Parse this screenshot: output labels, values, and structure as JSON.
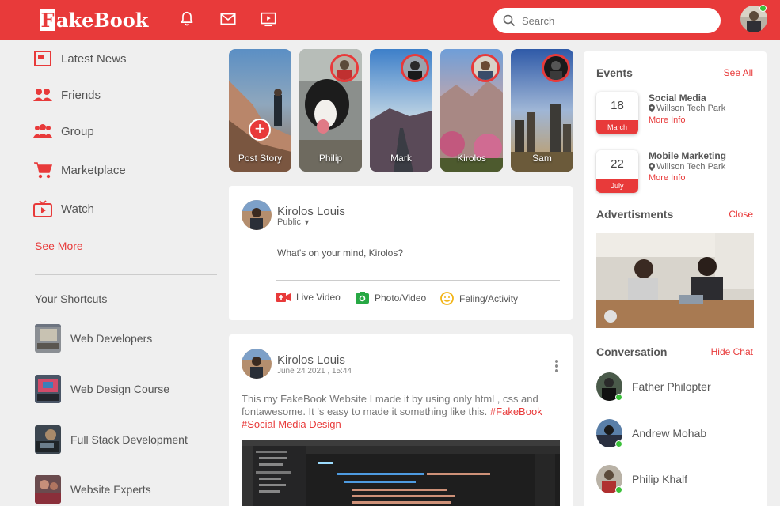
{
  "brand": {
    "first_letter": "F",
    "rest": "akeBook"
  },
  "nav": {
    "icons": [
      "bell-icon",
      "envelope-icon",
      "video-icon"
    ],
    "search_placeholder": "Search"
  },
  "colors": {
    "brand_red": "#e83a3a",
    "online": "#3cc13b"
  },
  "sidebar": {
    "items": [
      {
        "label": "Latest News",
        "icon": "news-icon"
      },
      {
        "label": "Friends",
        "icon": "friends-icon"
      },
      {
        "label": "Group",
        "icon": "group-icon"
      },
      {
        "label": "Marketplace",
        "icon": "cart-icon"
      },
      {
        "label": "Watch",
        "icon": "tv-icon"
      }
    ],
    "see_more": "See More",
    "shortcuts_title": "Your Shortcuts",
    "shortcuts": [
      {
        "label": "Web Developers"
      },
      {
        "label": "Web Design Course"
      },
      {
        "label": "Full Stack Development"
      },
      {
        "label": "Website Experts"
      }
    ]
  },
  "stories": [
    {
      "name": "Post Story"
    },
    {
      "name": "Philip"
    },
    {
      "name": "Mark"
    },
    {
      "name": "Kirolos"
    },
    {
      "name": "Sam"
    }
  ],
  "composer": {
    "user": "Kirolos Louis",
    "privacy": "Public",
    "placeholder": "What's on your mind, Kirolos?",
    "actions": [
      {
        "label": "Live Video",
        "icon": "live-video-icon"
      },
      {
        "label": "Photo/Video",
        "icon": "camera-icon"
      },
      {
        "label": "Feling/Activity",
        "icon": "smile-icon"
      }
    ]
  },
  "post": {
    "user": "Kirolos Louis",
    "date": "June 24 2021 , 15:44",
    "text": "This my FakeBook Website I made it by using only html , css and fontawesome. It 's easy to made it something like this.",
    "tags": [
      "#FakeBook",
      "#Social Media Design"
    ]
  },
  "events": {
    "title": "Events",
    "see_all": "See All",
    "items": [
      {
        "day": "18",
        "month": "March",
        "title": "Social Media",
        "location": "Willson Tech Park",
        "more": "More Info"
      },
      {
        "day": "22",
        "month": "July",
        "title": "Mobile Marketing",
        "location": "Willson Tech Park",
        "more": "More Info"
      }
    ]
  },
  "ads": {
    "title": "Advertisments",
    "close": "Close"
  },
  "conversation": {
    "title": "Conversation",
    "hide": "Hide Chat",
    "people": [
      {
        "name": "Father Philopter"
      },
      {
        "name": "Andrew Mohab"
      },
      {
        "name": "Philip Khalf"
      }
    ]
  }
}
